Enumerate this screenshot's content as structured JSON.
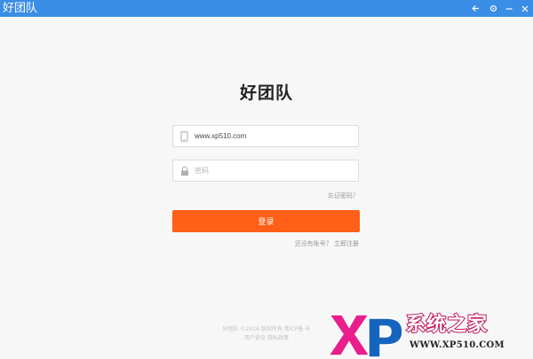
{
  "window": {
    "app_name": "好团队",
    "back_icon": "back-arrow-icon",
    "settings_icon": "gear-icon",
    "minimize_icon": "minimize-icon",
    "close_icon": "close-icon"
  },
  "login": {
    "title": "好团队",
    "account_value": "www.xp510.com",
    "account_icon": "phone-icon",
    "password_placeholder": "密码",
    "password_icon": "lock-icon",
    "forgot_label": "忘记密码？",
    "login_button_label": "登录",
    "register_prompt": "还没有账号？",
    "register_link": "立即注册"
  },
  "footer": {
    "line1": "好团队 ©2016 版权所有 粤ICP备 号",
    "line2": "用户协议 隐私政策"
  },
  "watermark": {
    "logo_letters": "XP",
    "brand_name": "系统之家",
    "url": "WWW.XP510.COM",
    "accent_color": "#e91e8c"
  },
  "colors": {
    "titlebar": "#3a8ee6",
    "login_button": "#ff5f16",
    "background": "#f7f7f8"
  }
}
